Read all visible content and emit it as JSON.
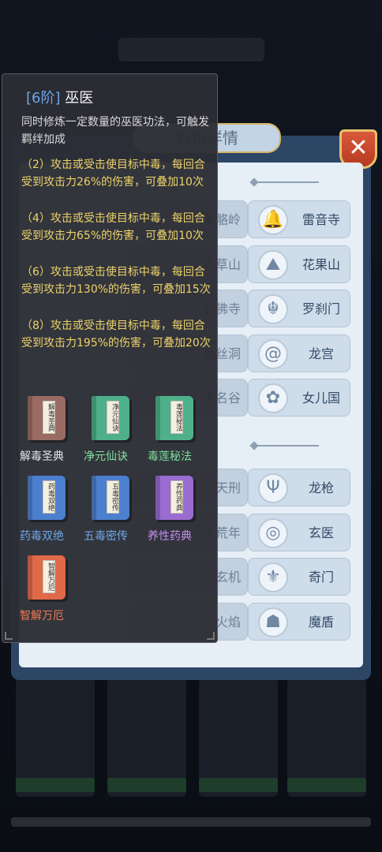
{
  "background": {
    "title": "",
    "cards": 4
  },
  "dialog": {
    "title": "百科详情",
    "close_label": "✕",
    "schools_group1": [
      {
        "label": "雷音寺",
        "icon": "bell-icon",
        "left_label": "骨骼岭"
      },
      {
        "label": "花果山",
        "icon": "mountain-icon",
        "left_label": "香草山"
      },
      {
        "label": "罗刹门",
        "icon": "demon-mask-icon",
        "left_label": "石佛寺"
      },
      {
        "label": "龙宫",
        "icon": "wave-icon",
        "left_label": "盘丝洞"
      },
      {
        "label": "女儿国",
        "icon": "lotus-icon",
        "left_label": "无名谷"
      }
    ],
    "schools_group2": [
      {
        "label": "龙枪",
        "icon": "trident-icon",
        "left_label": "天刑"
      },
      {
        "label": "玄医",
        "icon": "swirl-icon",
        "left_label": "大荒年"
      },
      {
        "label": "奇门",
        "icon": "flower-crest-icon",
        "left_label": "玄机"
      },
      {
        "label": "魔盾",
        "icon": "beast-face-icon",
        "left_label": "火焰"
      }
    ]
  },
  "tooltip": {
    "tier": "[6阶]",
    "name": "巫医",
    "description": "同时修炼一定数量的巫医功法，可触发羁绊加成",
    "effects": [
      "（2）攻击或受击使目标中毒，每回合受到攻击力26%的伤害，可叠加10次",
      "（4）攻击或受击使目标中毒，每回合受到攻击力65%的伤害，可叠加10次",
      "（6）攻击或受击使目标中毒，每回合受到攻击力130%的伤害，可叠加15次",
      "（8）攻击或受击使目标中毒，每回合受到攻击力195%的伤害，可叠加20次"
    ],
    "books": [
      {
        "name": "解毒圣典",
        "cover_text": "解毒圣典",
        "color": "#9a6b62",
        "name_color": "#e6e6e6"
      },
      {
        "name": "净元仙诀",
        "cover_text": "净元仙诀",
        "color": "#4eb08a",
        "name_color": "#7fe0a0"
      },
      {
        "name": "毒莲秘法",
        "cover_text": "毒莲秘法",
        "color": "#4eb08a",
        "name_color": "#7fe0a0"
      },
      {
        "name": "药毒双绝",
        "cover_text": "药毒双绝",
        "color": "#4c7fce",
        "name_color": "#6fa8e8"
      },
      {
        "name": "五毒密传",
        "cover_text": "五毒密传",
        "color": "#4c7fce",
        "name_color": "#6fa8e8"
      },
      {
        "name": "养性药典",
        "cover_text": "养性药典",
        "color": "#9a6bd0",
        "name_color": "#c48ef0"
      },
      {
        "name": "智解万厄",
        "cover_text": "智解万厄",
        "color": "#e0694a",
        "name_color": "#f07a52"
      }
    ]
  }
}
